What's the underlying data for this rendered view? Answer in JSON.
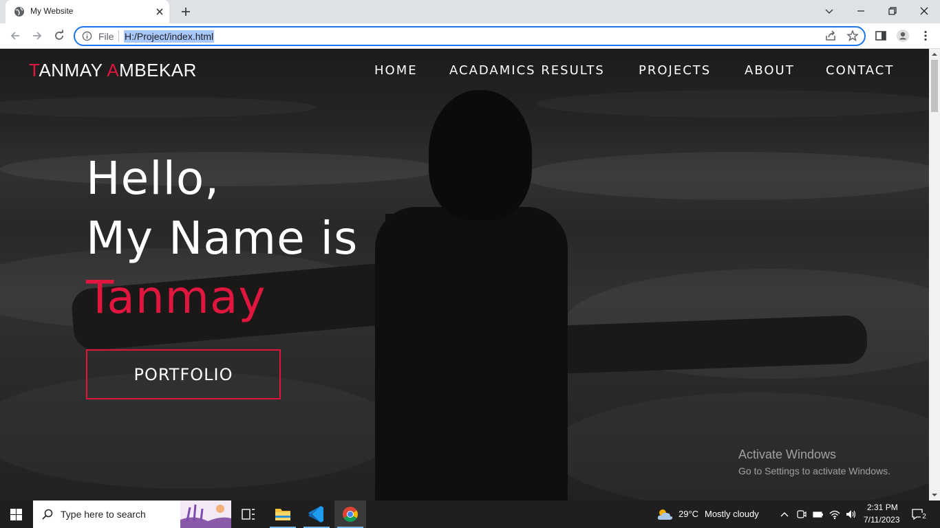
{
  "browser": {
    "tab_title": "My Website",
    "address_scheme": "File",
    "url": "H:/Project/index.html"
  },
  "site": {
    "logo": {
      "first_initial": "T",
      "first_rest": "ANMAY ",
      "last_initial": "A",
      "last_rest": "MBEKAR"
    },
    "nav": [
      "HOME",
      "ACADAMICS RESULTS",
      "PROJECTS",
      "ABOUT",
      "CONTACT"
    ],
    "hero": {
      "line1": "Hello,",
      "line2": "My Name is",
      "name": "Tanmay"
    },
    "cta_label": "PORTFOLIO",
    "accent_color": "#e0163f"
  },
  "watermark": {
    "title": "Activate Windows",
    "subtitle": "Go to Settings to activate Windows."
  },
  "taskbar": {
    "search_placeholder": "Type here to search",
    "weather_temp": "29°C",
    "weather_desc": "Mostly cloudy",
    "time": "2:31 PM",
    "date": "7/11/2023",
    "notification_count": "2"
  }
}
